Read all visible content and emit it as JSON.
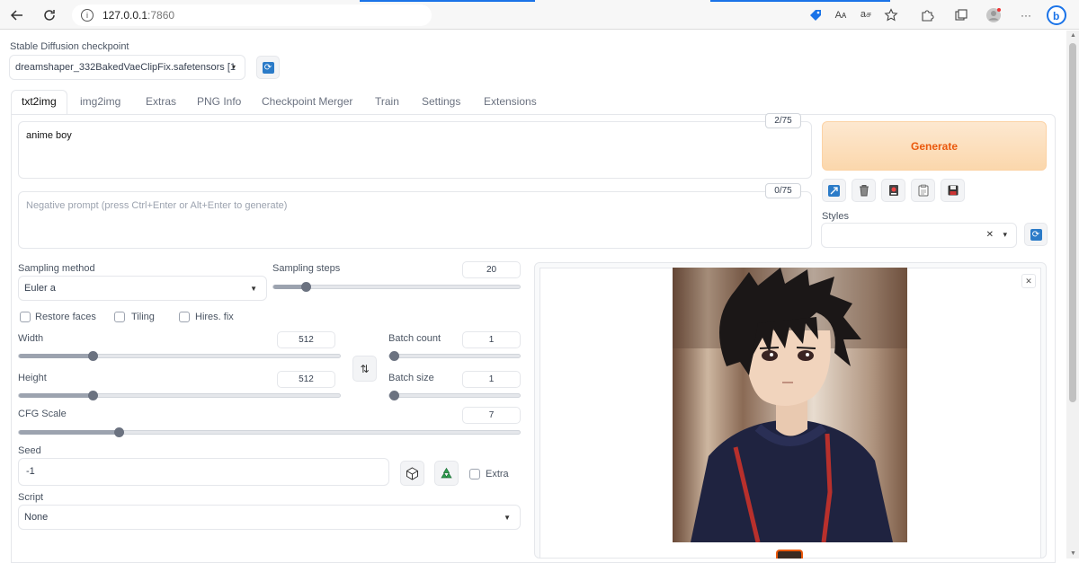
{
  "browser": {
    "url_host": "127.0.0.1",
    "url_port": ":7860",
    "toolbar_texts": {
      "read_aloud": "Aᴀ",
      "translate": "aச"
    },
    "more": "···",
    "bing": "b"
  },
  "checkpoint": {
    "label": "Stable Diffusion checkpoint",
    "value": "dreamshaper_332BakedVaeClipFix.safetensors [1"
  },
  "tabs": [
    "txt2img",
    "img2img",
    "Extras",
    "PNG Info",
    "Checkpoint Merger",
    "Train",
    "Settings",
    "Extensions"
  ],
  "prompt": {
    "value": "anime boy",
    "tokens": "2/75"
  },
  "negative_prompt": {
    "placeholder": "Negative prompt (press Ctrl+Enter or Alt+Enter to generate)",
    "tokens": "0/75"
  },
  "generate_label": "Generate",
  "styles": {
    "label": "Styles",
    "clear": "✕",
    "caret": "▾"
  },
  "sampling": {
    "method_label": "Sampling method",
    "method_value": "Euler a",
    "steps_label": "Sampling steps",
    "steps_value": "20",
    "steps_fraction": 0.13
  },
  "checkboxes": {
    "restore_faces": "Restore faces",
    "tiling": "Tiling",
    "hires_fix": "Hires. fix",
    "extra": "Extra"
  },
  "width": {
    "label": "Width",
    "value": "512",
    "fraction": 0.23
  },
  "height": {
    "label": "Height",
    "value": "512",
    "fraction": 0.23
  },
  "batch_count": {
    "label": "Batch count",
    "value": "1",
    "fraction": 0.0
  },
  "batch_size": {
    "label": "Batch size",
    "value": "1",
    "fraction": 0.0
  },
  "cfg": {
    "label": "CFG Scale",
    "value": "7",
    "fraction": 0.2
  },
  "seed": {
    "label": "Seed",
    "value": "-1"
  },
  "script": {
    "label": "Script",
    "value": "None"
  },
  "swap_icon": "⇅",
  "close_icon": "✕",
  "colors": {
    "accent_orange": "#ea580c",
    "generate_bg": "#fbd7ac",
    "refresh_blue": "#2b7bc8"
  }
}
